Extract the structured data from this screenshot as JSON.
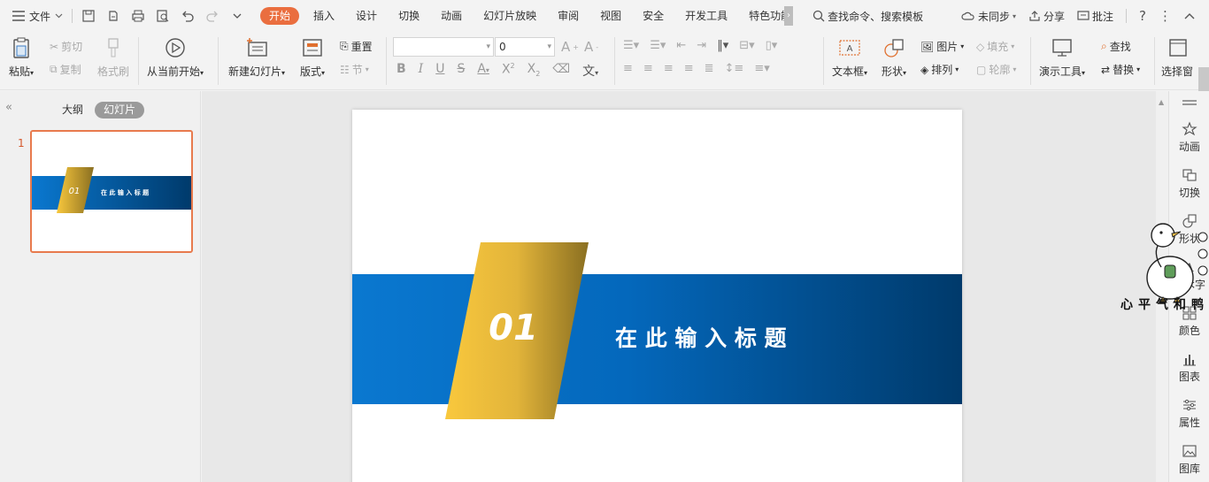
{
  "menu": {
    "file_label": "文件"
  },
  "tabs": [
    {
      "label": "开始",
      "active": true
    },
    {
      "label": "插入"
    },
    {
      "label": "设计"
    },
    {
      "label": "切换"
    },
    {
      "label": "动画"
    },
    {
      "label": "幻灯片放映"
    },
    {
      "label": "审阅"
    },
    {
      "label": "视图"
    },
    {
      "label": "安全"
    },
    {
      "label": "开发工具"
    },
    {
      "label": "特色功能"
    }
  ],
  "search": {
    "placeholder": "查找命令、搜索模板"
  },
  "topright": {
    "sync": "未同步",
    "share": "分享",
    "comment": "批注"
  },
  "ribbon": {
    "paste": "粘贴",
    "cut": "剪切",
    "copy": "复制",
    "format_painter": "格式刷",
    "play_from_current": "从当前开始",
    "new_slide": "新建幻灯片",
    "layout": "版式",
    "reset": "重置",
    "section": "节",
    "font_name": "",
    "font_size": "0",
    "textbox": "文本框",
    "shape": "形状",
    "picture": "图片",
    "fill": "填充",
    "arrange": "排列",
    "outline": "轮廓",
    "present_tools": "演示工具",
    "find": "查找",
    "replace": "替换",
    "select_pane": "选择窗"
  },
  "leftpane": {
    "outline_tab": "大纲",
    "slides_tab": "幻灯片",
    "slide_number": "1"
  },
  "slide": {
    "number": "01",
    "title": "在 此 输 入 标 题"
  },
  "thumb": {
    "number": "01",
    "title": "在 此 输 入 标 题"
  },
  "sidepanel": [
    {
      "label": "动画",
      "icon": "star-icon"
    },
    {
      "label": "切换",
      "icon": "transition-icon"
    },
    {
      "label": "形状",
      "icon": "shape-icon"
    },
    {
      "label": "艺术字",
      "icon": "wordart-icon"
    },
    {
      "label": "颜色",
      "icon": "color-icon"
    },
    {
      "label": "图表",
      "icon": "chart-icon"
    },
    {
      "label": "属性",
      "icon": "sliders-icon"
    },
    {
      "label": "图库",
      "icon": "gallery-icon"
    }
  ],
  "watermark": {
    "text": "心平气和鸭"
  },
  "colors": {
    "accent": "#ea6e3f",
    "banner_start": "#0a78d0",
    "banner_end": "#003a6b",
    "gold_start": "#f9c83d",
    "gold_end": "#8a6f21"
  }
}
